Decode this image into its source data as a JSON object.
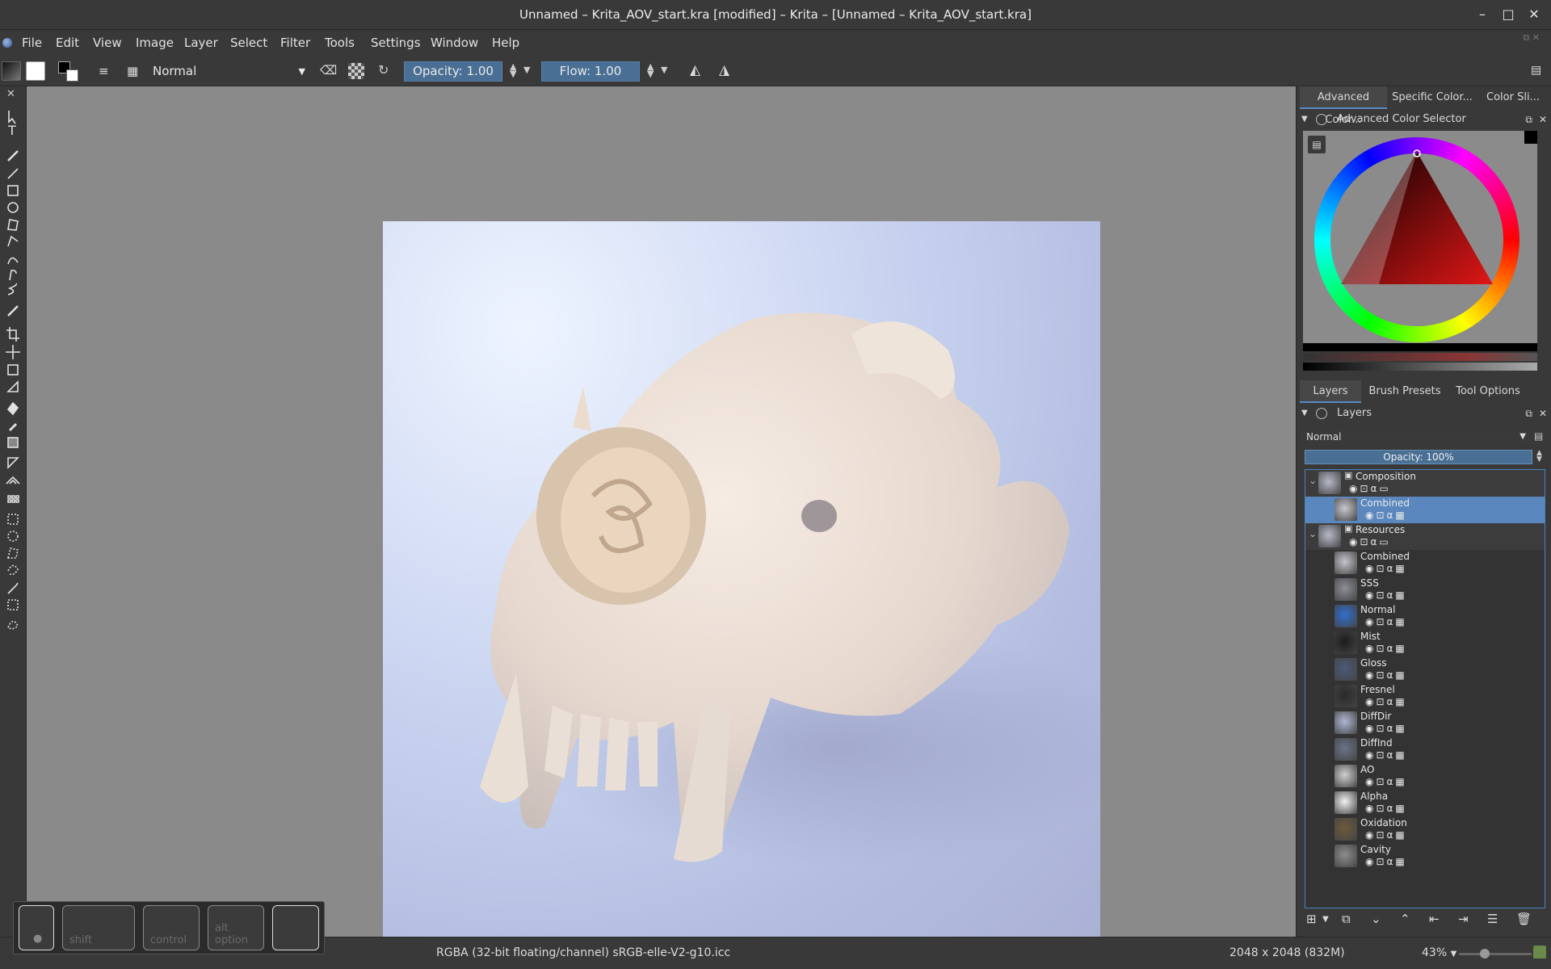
{
  "window": {
    "title": "Unnamed – Krita_AOV_start.kra [modified] – Krita – [Unnamed – Krita_AOV_start.kra]",
    "minimize": "–",
    "maximize": "□",
    "close": "✕"
  },
  "menu": [
    "File",
    "Edit",
    "View",
    "Image",
    "Layer",
    "Select",
    "Filter",
    "Tools",
    "Settings",
    "Window",
    "Help"
  ],
  "tool_options": {
    "blend_mode": "Normal",
    "opacity_label": "Opacity:  1.00",
    "flow_label": "Flow:  1.00"
  },
  "dock": {
    "top_tabs": [
      "Advanced Color...",
      "Specific Color...",
      "Color Sli..."
    ],
    "color_selector_title": "Advanced Color Selector",
    "mid_tabs": [
      "Layers",
      "Brush Presets",
      "Tool Options"
    ],
    "layers_title": "Layers",
    "blend_mode": "Normal",
    "opacity_label": "Opacity:  100%"
  },
  "layers": [
    {
      "name": "Composition",
      "group": true,
      "indent": 0,
      "selected": false,
      "thumb": "#b7b9c9"
    },
    {
      "name": "Combined",
      "group": false,
      "indent": 1,
      "selected": true,
      "thumb": "#c9c7cf"
    },
    {
      "name": "Resources",
      "group": true,
      "indent": 0,
      "selected": false,
      "thumb": "#b7b9c9"
    },
    {
      "name": "Combined",
      "group": false,
      "indent": 1,
      "selected": false,
      "thumb": "#c6c4cc"
    },
    {
      "name": "SSS",
      "group": false,
      "indent": 1,
      "selected": false,
      "thumb": "#8d8f96"
    },
    {
      "name": "Normal",
      "group": false,
      "indent": 1,
      "selected": false,
      "thumb": "#2f6fd0"
    },
    {
      "name": "Mist",
      "group": false,
      "indent": 1,
      "selected": false,
      "thumb": "#1c1c1c"
    },
    {
      "name": "Gloss",
      "group": false,
      "indent": 1,
      "selected": false,
      "thumb": "#4a5a78"
    },
    {
      "name": "Fresnel",
      "group": false,
      "indent": 1,
      "selected": false,
      "thumb": "#2a2a2a"
    },
    {
      "name": "DiffDir",
      "group": false,
      "indent": 1,
      "selected": false,
      "thumb": "#aeb6d4"
    },
    {
      "name": "DiffInd",
      "group": false,
      "indent": 1,
      "selected": false,
      "thumb": "#6a7388"
    },
    {
      "name": "AO",
      "group": false,
      "indent": 1,
      "selected": false,
      "thumb": "#cfcfcf"
    },
    {
      "name": "Alpha",
      "group": false,
      "indent": 1,
      "selected": false,
      "thumb": "#f2f2f2"
    },
    {
      "name": "Oxidation",
      "group": false,
      "indent": 1,
      "selected": false,
      "thumb": "#6e5a3a"
    },
    {
      "name": "Cavity",
      "group": false,
      "indent": 1,
      "selected": false,
      "thumb": "#8c8c8c"
    }
  ],
  "status": {
    "color_space": "RGBA (32-bit floating/channel)  sRGB-elle-V2-g10.icc",
    "image_size": "2048 x 2048 (832M)",
    "zoom": "43%"
  },
  "modifier_keys": [
    "",
    "shift",
    "control",
    "alt\noption",
    ""
  ]
}
